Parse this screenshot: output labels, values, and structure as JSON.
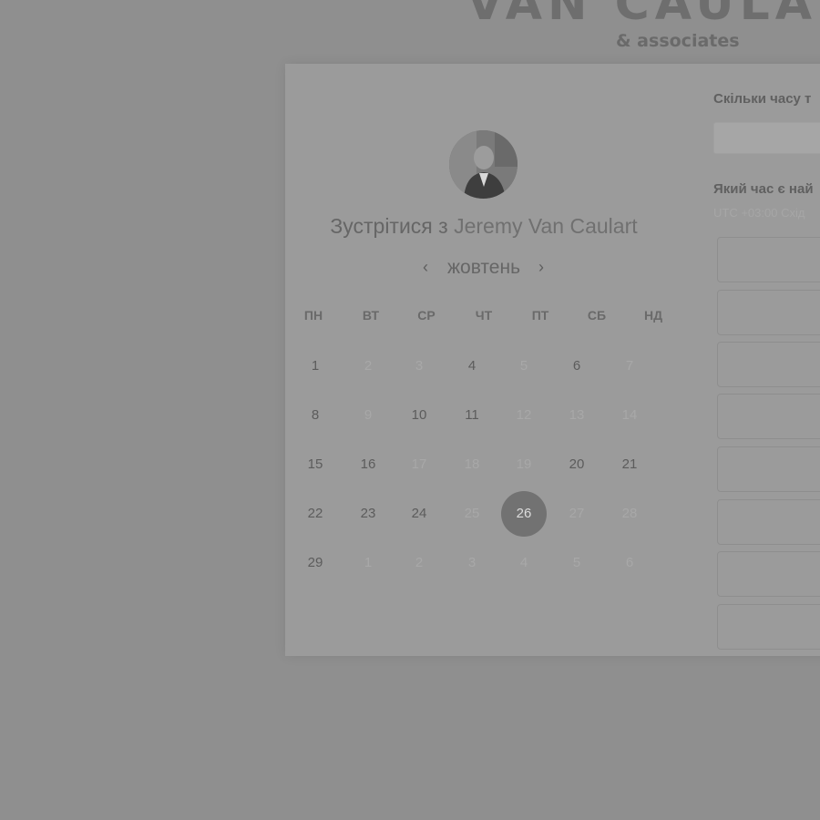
{
  "brand": {
    "name": "VAN CAULA",
    "tagline": "& associates"
  },
  "meeting": {
    "prefix": "Зустрітися з",
    "host": "Jeremy Van Caulart"
  },
  "calendar": {
    "month": "жовтень",
    "prev_label": "‹",
    "next_label": "›",
    "weekdays": [
      "ПН",
      "ВТ",
      "СР",
      "ЧТ",
      "ПТ",
      "СБ",
      "НД"
    ],
    "weeks": [
      [
        {
          "d": "1",
          "a": true
        },
        {
          "d": "2",
          "a": false
        },
        {
          "d": "3",
          "a": false
        },
        {
          "d": "4",
          "a": true
        },
        {
          "d": "5",
          "a": false
        },
        {
          "d": "6",
          "a": true
        },
        {
          "d": "7",
          "a": false
        }
      ],
      [
        {
          "d": "8",
          "a": true
        },
        {
          "d": "9",
          "a": false
        },
        {
          "d": "10",
          "a": true
        },
        {
          "d": "11",
          "a": true
        },
        {
          "d": "12",
          "a": false
        },
        {
          "d": "13",
          "a": false
        },
        {
          "d": "14",
          "a": false
        }
      ],
      [
        {
          "d": "15",
          "a": true
        },
        {
          "d": "16",
          "a": true
        },
        {
          "d": "17",
          "a": false
        },
        {
          "d": "18",
          "a": false
        },
        {
          "d": "19",
          "a": false
        },
        {
          "d": "20",
          "a": true
        },
        {
          "d": "21",
          "a": true
        }
      ],
      [
        {
          "d": "22",
          "a": true
        },
        {
          "d": "23",
          "a": true
        },
        {
          "d": "24",
          "a": true
        },
        {
          "d": "25",
          "a": false
        },
        {
          "d": "26",
          "a": true,
          "selected": true
        },
        {
          "d": "27",
          "a": false
        },
        {
          "d": "28",
          "a": false
        }
      ],
      [
        {
          "d": "29",
          "a": true
        },
        {
          "d": "1",
          "a": false
        },
        {
          "d": "2",
          "a": false
        },
        {
          "d": "3",
          "a": false
        },
        {
          "d": "4",
          "a": false
        },
        {
          "d": "5",
          "a": false
        },
        {
          "d": "6",
          "a": false
        }
      ]
    ]
  },
  "booking": {
    "duration_question": "Скільки часу т",
    "time_question": "Який час є най",
    "timezone": "UTC +03:00 Схід"
  }
}
